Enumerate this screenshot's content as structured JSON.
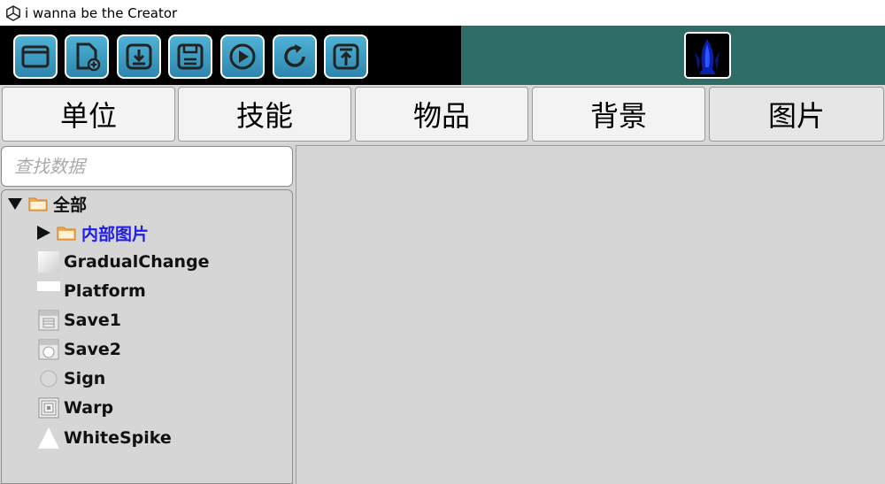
{
  "window": {
    "title": "i wanna be the Creator"
  },
  "toolbar": {
    "buttons": [
      {
        "name": "open-folder-button",
        "icon": "folder-icon"
      },
      {
        "name": "new-file-button",
        "icon": "new-file-icon"
      },
      {
        "name": "import-button",
        "icon": "download-icon"
      },
      {
        "name": "save-button",
        "icon": "save-icon"
      },
      {
        "name": "play-button",
        "icon": "play-icon"
      },
      {
        "name": "refresh-button",
        "icon": "refresh-icon"
      },
      {
        "name": "upload-button",
        "icon": "upload-icon"
      }
    ],
    "colors": {
      "button_fill": "#3b9fc4",
      "toolbar_bg": "#000000",
      "preview_bg": "#2e6c66"
    }
  },
  "tabs": [
    {
      "label": "单位"
    },
    {
      "label": "技能"
    },
    {
      "label": "物品"
    },
    {
      "label": "背景"
    },
    {
      "label": "图片",
      "active": true
    }
  ],
  "search": {
    "placeholder": "查找数据",
    "value": ""
  },
  "tree": {
    "root": {
      "label": "全部",
      "expanded": true
    },
    "folder": {
      "label": "内部图片",
      "expanded": false,
      "selected": true,
      "color": "#1e1ee6"
    },
    "items": [
      {
        "label": "GradualChange",
        "icon": "gradient-swatch-icon"
      },
      {
        "label": "Platform",
        "icon": "platform-icon"
      },
      {
        "label": "Save1",
        "icon": "save-block-icon"
      },
      {
        "label": "Save2",
        "icon": "save-block-alt-icon"
      },
      {
        "label": "Sign",
        "icon": "circle-sign-icon"
      },
      {
        "label": "Warp",
        "icon": "warp-square-icon"
      },
      {
        "label": "WhiteSpike",
        "icon": "spike-triangle-icon"
      }
    ]
  }
}
